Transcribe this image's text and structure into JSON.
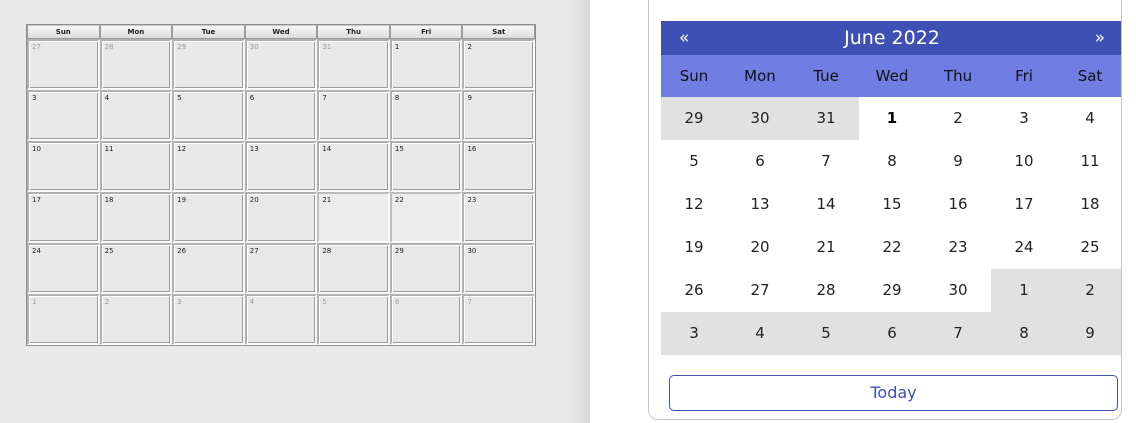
{
  "big_calendar": {
    "weekdays": [
      "Sun",
      "Mon",
      "Tue",
      "Wed",
      "Thu",
      "Fri",
      "Sat"
    ],
    "weeks": [
      [
        {
          "d": "27",
          "other": true
        },
        {
          "d": "28",
          "other": true
        },
        {
          "d": "29",
          "other": true
        },
        {
          "d": "30",
          "other": true
        },
        {
          "d": "31",
          "other": true
        },
        {
          "d": "1",
          "other": false
        },
        {
          "d": "2",
          "other": false
        }
      ],
      [
        {
          "d": "3",
          "other": false
        },
        {
          "d": "4",
          "other": false
        },
        {
          "d": "5",
          "other": false
        },
        {
          "d": "6",
          "other": false
        },
        {
          "d": "7",
          "other": false
        },
        {
          "d": "8",
          "other": false
        },
        {
          "d": "9",
          "other": false
        }
      ],
      [
        {
          "d": "10",
          "other": false
        },
        {
          "d": "11",
          "other": false
        },
        {
          "d": "12",
          "other": false
        },
        {
          "d": "13",
          "other": false
        },
        {
          "d": "14",
          "other": false
        },
        {
          "d": "15",
          "other": false
        },
        {
          "d": "16",
          "other": false
        }
      ],
      [
        {
          "d": "17",
          "other": false
        },
        {
          "d": "18",
          "other": false
        },
        {
          "d": "19",
          "other": false
        },
        {
          "d": "20",
          "other": false
        },
        {
          "d": "21",
          "other": false,
          "plain": true
        },
        {
          "d": "22",
          "other": false,
          "plain": true
        },
        {
          "d": "23",
          "other": false
        }
      ],
      [
        {
          "d": "24",
          "other": false
        },
        {
          "d": "25",
          "other": false
        },
        {
          "d": "26",
          "other": false
        },
        {
          "d": "27",
          "other": false
        },
        {
          "d": "28",
          "other": false
        },
        {
          "d": "29",
          "other": false
        },
        {
          "d": "30",
          "other": false
        }
      ],
      [
        {
          "d": "1",
          "other": true
        },
        {
          "d": "2",
          "other": true
        },
        {
          "d": "3",
          "other": true
        },
        {
          "d": "4",
          "other": true
        },
        {
          "d": "5",
          "other": true
        },
        {
          "d": "6",
          "other": true
        },
        {
          "d": "7",
          "other": true
        }
      ]
    ]
  },
  "picker": {
    "prev_label": "«",
    "next_label": "»",
    "month_title": "June 2022",
    "weekdays": [
      "Sun",
      "Mon",
      "Tue",
      "Wed",
      "Thu",
      "Fri",
      "Sat"
    ],
    "weeks": [
      [
        {
          "d": "29",
          "other": true
        },
        {
          "d": "30",
          "other": true
        },
        {
          "d": "31",
          "other": true
        },
        {
          "d": "1",
          "other": false,
          "today": true
        },
        {
          "d": "2",
          "other": false
        },
        {
          "d": "3",
          "other": false
        },
        {
          "d": "4",
          "other": false
        }
      ],
      [
        {
          "d": "5",
          "other": false
        },
        {
          "d": "6",
          "other": false
        },
        {
          "d": "7",
          "other": false
        },
        {
          "d": "8",
          "other": false
        },
        {
          "d": "9",
          "other": false
        },
        {
          "d": "10",
          "other": false
        },
        {
          "d": "11",
          "other": false
        }
      ],
      [
        {
          "d": "12",
          "other": false
        },
        {
          "d": "13",
          "other": false
        },
        {
          "d": "14",
          "other": false
        },
        {
          "d": "15",
          "other": false
        },
        {
          "d": "16",
          "other": false
        },
        {
          "d": "17",
          "other": false
        },
        {
          "d": "18",
          "other": false
        }
      ],
      [
        {
          "d": "19",
          "other": false
        },
        {
          "d": "20",
          "other": false
        },
        {
          "d": "21",
          "other": false
        },
        {
          "d": "22",
          "other": false
        },
        {
          "d": "23",
          "other": false
        },
        {
          "d": "24",
          "other": false
        },
        {
          "d": "25",
          "other": false
        }
      ],
      [
        {
          "d": "26",
          "other": false
        },
        {
          "d": "27",
          "other": false
        },
        {
          "d": "28",
          "other": false
        },
        {
          "d": "29",
          "other": false
        },
        {
          "d": "30",
          "other": false
        },
        {
          "d": "1",
          "other": true
        },
        {
          "d": "2",
          "other": true
        }
      ],
      [
        {
          "d": "3",
          "other": true
        },
        {
          "d": "4",
          "other": true
        },
        {
          "d": "5",
          "other": true
        },
        {
          "d": "6",
          "other": true
        },
        {
          "d": "7",
          "other": true
        },
        {
          "d": "8",
          "other": true
        },
        {
          "d": "9",
          "other": true
        }
      ]
    ],
    "today_label": "Today",
    "colors": {
      "header": "#3e50b4",
      "weekday_row": "#707ee3",
      "other_month_cell": "#e1e1e1"
    }
  }
}
